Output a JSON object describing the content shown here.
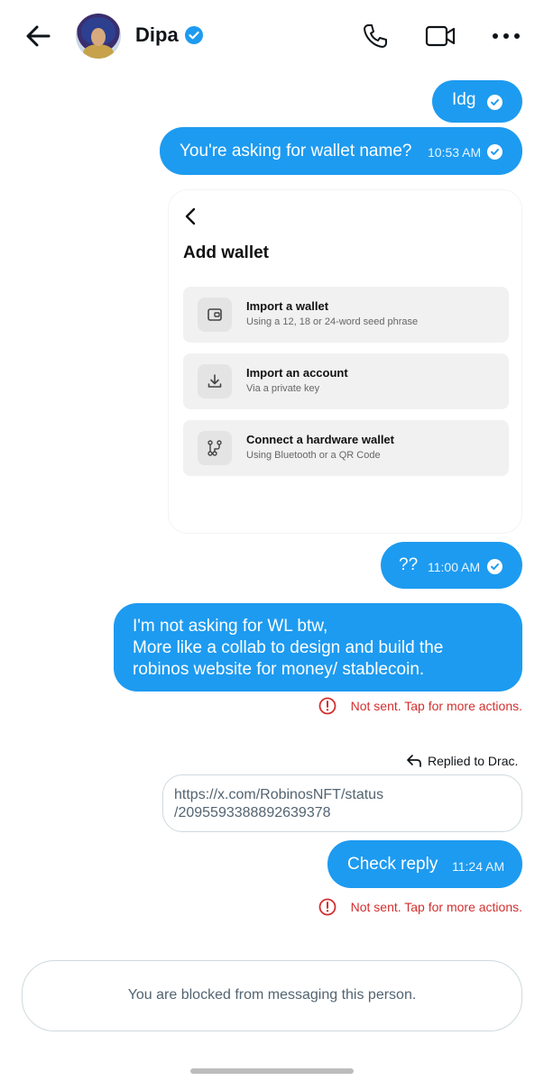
{
  "header": {
    "name": "Dipa",
    "icons": [
      "back-arrow-icon",
      "verified-badge-icon",
      "phone-icon",
      "video-icon",
      "more-icon"
    ],
    "accent": "#1d9bf0"
  },
  "messages": [
    {
      "text": "Idg",
      "time": ""
    },
    {
      "text": "You're asking for wallet name?",
      "time": "10:53 AM"
    },
    {
      "text": "??",
      "time": "11:00 AM"
    },
    {
      "lines": [
        "I'm not asking for WL btw,",
        "More like a collab to design and build the",
        "robinos website for money/ stablecoin."
      ]
    },
    {
      "text": "Check reply",
      "time": "11:24 AM"
    }
  ],
  "wallet_card": {
    "title": "Add wallet",
    "options": [
      {
        "title": "Import a wallet",
        "subtitle": "Using a 12, 18 or 24-word seed phrase",
        "icon": "wallet-icon"
      },
      {
        "title": "Import an account",
        "subtitle": "Via a private key",
        "icon": "download-icon"
      },
      {
        "title": "Connect a hardware wallet",
        "subtitle": "Using Bluetooth or a QR Code",
        "icon": "hardware-icon"
      }
    ]
  },
  "error_text": "Not sent. Tap for more actions.",
  "reply": {
    "label": "Replied to Drac.",
    "url_lines": [
      "https://x.com/RobinosNFT/status",
      "/2095593388892639378"
    ]
  },
  "blocked_text": "You are blocked from messaging this person.",
  "colors": {
    "error": "#d32f2f",
    "muted": "#536471"
  }
}
